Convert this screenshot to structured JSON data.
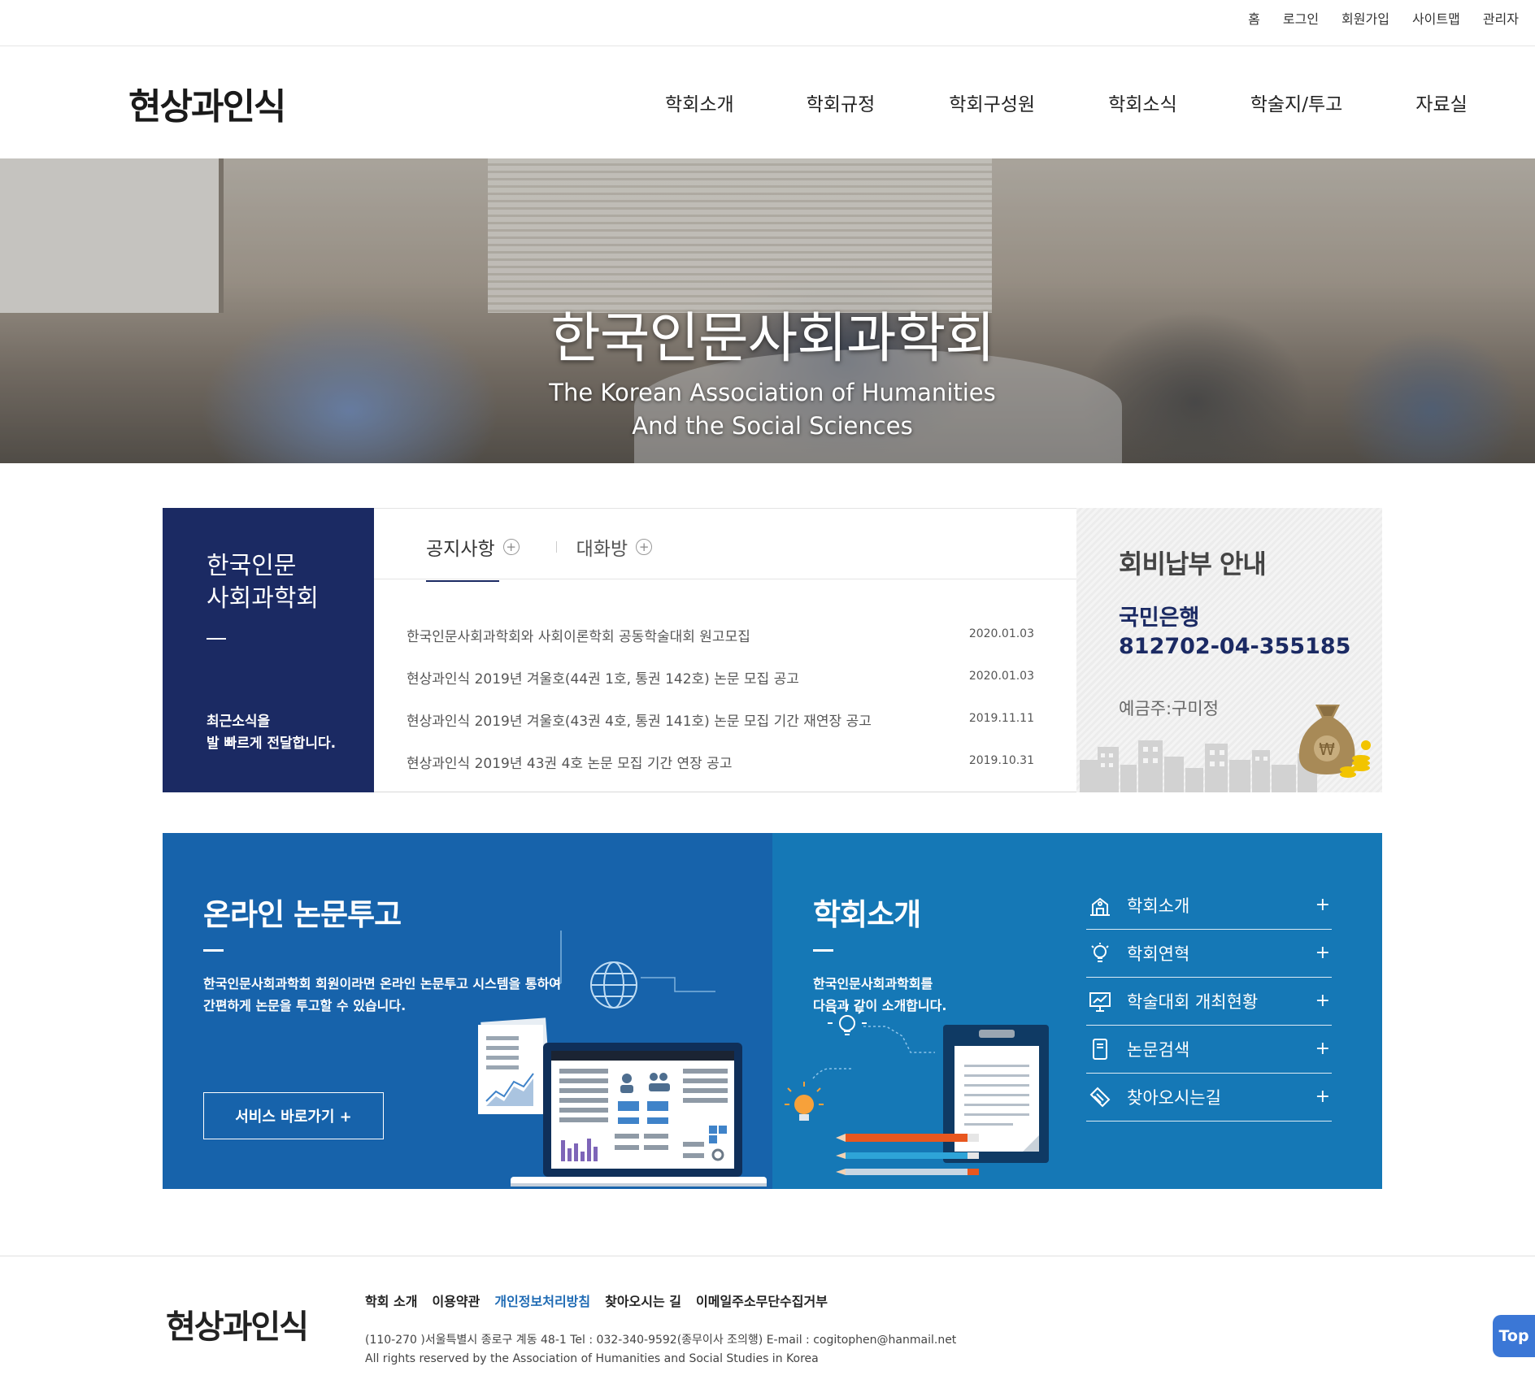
{
  "util_menu": [
    "홈",
    "로그인",
    "회원가입",
    "사이트맵",
    "관리자"
  ],
  "logo_text": "현상과인식",
  "gnb": [
    "학회소개",
    "학회규정",
    "학회구성원",
    "학회소식",
    "학술지/투고",
    "자료실"
  ],
  "hero": {
    "title": "한국인문사회과학회",
    "subtitle_line1": "The Korean Association of Humanities",
    "subtitle_line2": "And the Social Sciences"
  },
  "intro_box": {
    "title_line1": "한국인문",
    "title_line2": "사회과학회",
    "sub_line1": "최근소식을",
    "sub_line2": "발 빠르게 전달합니다."
  },
  "board": {
    "tabs": [
      "공지사항",
      "대화방"
    ],
    "active_tab": "공지사항",
    "plus_glyph": "+",
    "items": [
      {
        "title": "한국인문사회과학회와 사회이론학회 공동학술대회 원고모집",
        "date": "2020.01.03"
      },
      {
        "title": "현상과인식 2019년 겨울호(44권 1호, 통권 142호) 논문 모집 공고",
        "date": "2020.01.03"
      },
      {
        "title": "현상과인식 2019년 겨울호(43권 4호, 통권 141호) 논문 모집 기간 재연장 공고",
        "date": "2019.11.11"
      },
      {
        "title": "현상과인식 2019년 43권 4호 논문 모집 기간 연장 공고",
        "date": "2019.10.31"
      }
    ]
  },
  "fee": {
    "title": "회비납부 안내",
    "bank": "국민은행",
    "account": "812702-04-355185",
    "holder": "예금주:구미정",
    "coin_symbol": "₩"
  },
  "online": {
    "title": "온라인 논문투고",
    "desc_line1": "한국인문사회과학회 회원이라면 온라인 논문투고 시스템을 통하여",
    "desc_line2": "간편하게 논문을 투고할 수 있습니다.",
    "button": "서비스 바로가기 +"
  },
  "society": {
    "title": "학회소개",
    "desc_line1": "한국인문사회과학회를",
    "desc_line2": "다음과 같이 소개합니다.",
    "plus_glyph": "+",
    "links": [
      {
        "label": "학회소개",
        "icon": "building-icon"
      },
      {
        "label": "학회연혁",
        "icon": "lightbulb-icon"
      },
      {
        "label": "학술대회 개최현황",
        "icon": "presentation-chart-icon"
      },
      {
        "label": "논문검색",
        "icon": "document-icon"
      },
      {
        "label": "찾아오시는길",
        "icon": "pin-tag-icon"
      }
    ]
  },
  "footer": {
    "logo_text": "현상과인식",
    "links": [
      "학회 소개",
      "이용약관",
      "개인정보처리방침",
      "찾아오시는 길",
      "이메일주소무단수집거부"
    ],
    "highlight_link": "개인정보처리방침",
    "address": "(110-270 )서울특별시 종로구 계동 48-1 Tel : 032-340-9592(종무이사 조의행) E-mail : cogitophen@hanmail.net",
    "copyright": "All rights reserved by the Association of Humanities and Social Studies in Korea"
  },
  "top_button": "Top",
  "colors": {
    "navy": "#1b2a63",
    "blue_left": "#1763ab",
    "blue_right": "#1578b6",
    "footer_highlight": "#1f6bb4",
    "top_button": "#3b77d6"
  }
}
